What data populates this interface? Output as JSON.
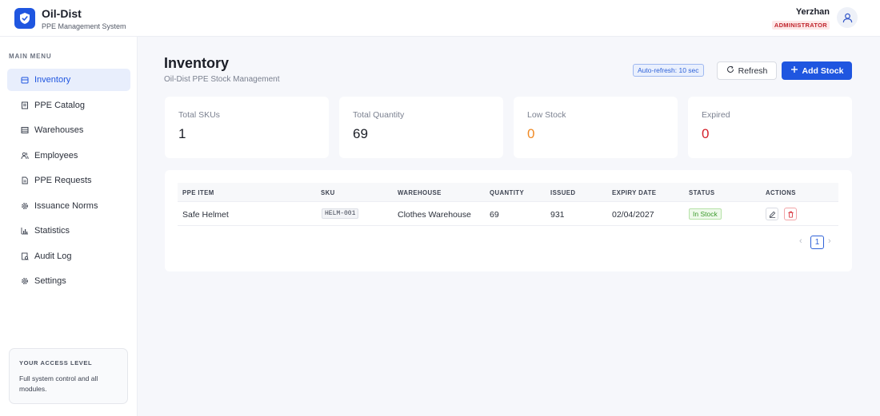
{
  "app": {
    "name": "Oil-Dist",
    "subtitle": "PPE Management System"
  },
  "user": {
    "name": "Yerzhan",
    "role": "ADMINISTRATOR"
  },
  "sidebar": {
    "heading": "MAIN MENU",
    "items": [
      {
        "label": "Inventory",
        "icon": "archive-icon",
        "active": true
      },
      {
        "label": "PPE Catalog",
        "icon": "catalog-icon"
      },
      {
        "label": "Warehouses",
        "icon": "warehouse-icon"
      },
      {
        "label": "Employees",
        "icon": "users-icon"
      },
      {
        "label": "PPE Requests",
        "icon": "document-icon"
      },
      {
        "label": "Issuance Norms",
        "icon": "gear-icon"
      },
      {
        "label": "Statistics",
        "icon": "bar-chart-icon"
      },
      {
        "label": "Audit Log",
        "icon": "audit-icon"
      },
      {
        "label": "Settings",
        "icon": "settings-icon"
      }
    ],
    "access": {
      "title": "YOUR ACCESS LEVEL",
      "description": "Full system control and all modules."
    }
  },
  "page": {
    "title": "Inventory",
    "subtitle": "Oil-Dist PPE Stock Management",
    "auto_refresh": "Auto-refresh: 10 sec",
    "refresh_label": "Refresh",
    "add_label": "Add Stock"
  },
  "stats": [
    {
      "label": "Total SKUs",
      "value": "1",
      "color": "#1b1e27"
    },
    {
      "label": "Total Quantity",
      "value": "69",
      "color": "#1b1e27"
    },
    {
      "label": "Low Stock",
      "value": "0",
      "color": "#f08a24"
    },
    {
      "label": "Expired",
      "value": "0",
      "color": "#d4202b"
    }
  ],
  "table": {
    "columns": [
      "PPE ITEM",
      "SKU",
      "WAREHOUSE",
      "QUANTITY",
      "ISSUED",
      "EXPIRY DATE",
      "STATUS",
      "ACTIONS"
    ],
    "rows": [
      {
        "item": "Safe Helmet",
        "sku": "HELM-001",
        "warehouse": "Clothes Warehouse",
        "quantity": "69",
        "issued": "931",
        "expiry": "02/04/2027",
        "status": "In Stock"
      }
    ],
    "pagination": {
      "current_page": "1",
      "prev": "‹",
      "next": "›"
    }
  },
  "colors": {
    "primary": "#1f56e0",
    "danger": "#d4202b",
    "warning": "#f08a24",
    "success": "#3b9a2c"
  }
}
